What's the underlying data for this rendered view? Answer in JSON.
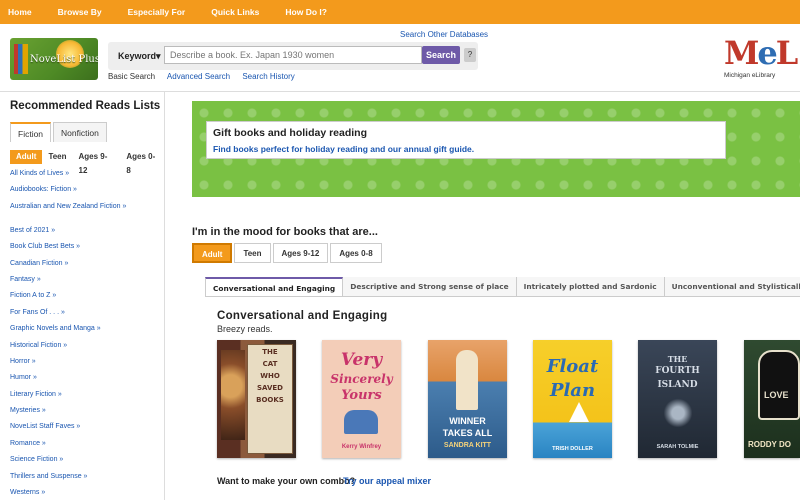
{
  "topnav": {
    "items": [
      "Home",
      "Browse By",
      "Especially For",
      "Quick Links",
      "How Do I?"
    ]
  },
  "header": {
    "logo_text": "NoveList Plus",
    "search_other": "Search Other Databases",
    "keyword_select": "Keyword",
    "search_placeholder": "Describe a book. Ex. Japan 1930 women",
    "search_button": "Search",
    "help": "?",
    "links": [
      "Basic Search",
      "Advanced Search",
      "Search History"
    ],
    "mel_letters": "MeL",
    "mel_sub": "Michigan eLibrary"
  },
  "sidebar": {
    "title": "Recommended Reads Lists",
    "tabs": [
      "Fiction",
      "Nonfiction"
    ],
    "ages": [
      "Adult",
      "Teen",
      "Ages 9-12",
      "Ages 0-8"
    ],
    "items": [
      "All Kinds of Lives »",
      "Audiobooks: Fiction »",
      "Australian and New Zealand Fiction »",
      "Best of 2021 »",
      "Book Club Best Bets »",
      "Canadian Fiction »",
      "Fantasy »",
      "Fiction A to Z »",
      "For Fans Of . . . »",
      "Graphic Novels and Manga »",
      "Historical Fiction »",
      "Horror »",
      "Humor »",
      "Literary Fiction »",
      "Mysteries »",
      "NoveList Staff Faves »",
      "Romance »",
      "Science Fiction »",
      "Thrillers and Suspense »",
      "Westerns »"
    ]
  },
  "promo": {
    "title": "Gift books and holiday reading",
    "subtitle": "Find books perfect for holiday reading and our annual gift guide."
  },
  "mood": {
    "heading": "I'm in the mood for books that are...",
    "tabs": [
      "Adult",
      "Teen",
      "Ages 9-12",
      "Ages 0-8"
    ],
    "appeal_tabs": [
      "Conversational and Engaging",
      "Descriptive and Strong sense of place",
      "Intricately plotted and Sardonic",
      "Unconventional and Stylistically co"
    ],
    "appeal_title": "Conversational and Engaging",
    "appeal_desc": "Breezy reads.",
    "covers": [
      {
        "line1": "THE",
        "line2": "CAT",
        "line3": "WHO",
        "line4": "SAVED",
        "line5": "BOOKS",
        "color": "#6b3a2a"
      },
      {
        "line1": "Very",
        "line2": "Sincerely",
        "line3": "Yours",
        "author": "Kerry Winfrey",
        "color": "#f1cbb7"
      },
      {
        "line1": "WINNER",
        "line2": "TAKES ALL",
        "author": "SANDRA KITT",
        "color": "#3b6e9c"
      },
      {
        "line1": "Float",
        "line2": "Plan",
        "author": "TRISH DOLLER",
        "color": "#f4c91f"
      },
      {
        "line1": "THE",
        "line2": "FOURTH",
        "line3": "ISLAND",
        "author": "SARAH TOLMIE",
        "color": "#2a3340"
      },
      {
        "line1": "LOVE",
        "author": "RODDY DO",
        "color": "#1f3b24"
      }
    ],
    "combo_question": "Want to make your own combo?",
    "combo_link": "Try our appeal mixer"
  }
}
